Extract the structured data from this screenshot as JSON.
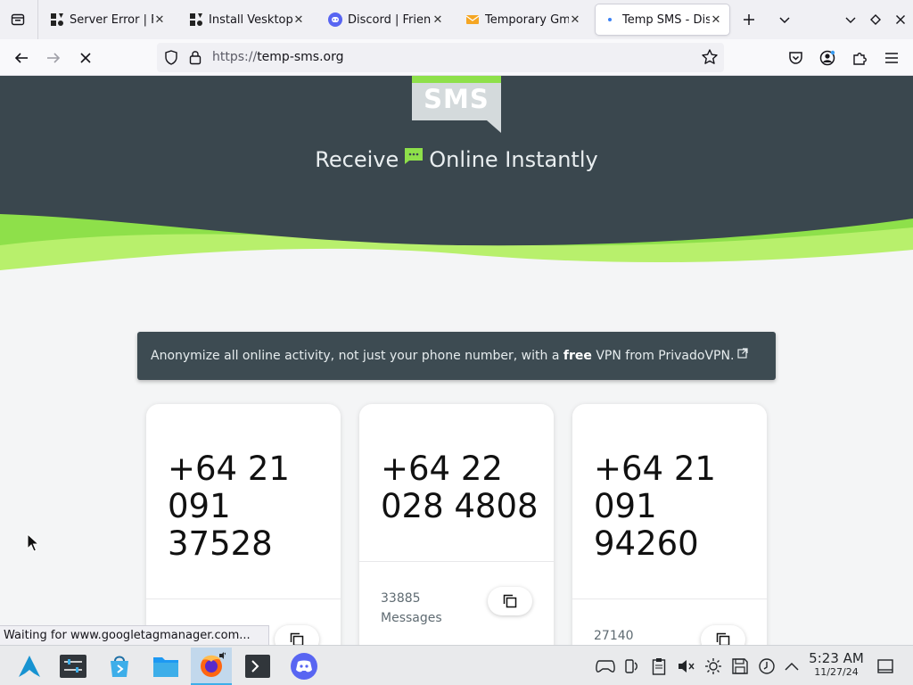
{
  "browser": {
    "tabs": [
      {
        "title": "Server Error | F",
        "icon": "bolt-app-icon"
      },
      {
        "title": "Install Vesktop",
        "icon": "bolt-app-icon"
      },
      {
        "title": "Discord | Frien",
        "icon": "discord-icon"
      },
      {
        "title": "Temporary Gm",
        "icon": "mail-icon"
      },
      {
        "title": "Temp SMS - Dis",
        "icon": "loading-dot-icon",
        "active": true
      }
    ],
    "close_glyph": "✕",
    "url_scheme": "https://",
    "url_host": "temp-sms.org"
  },
  "page": {
    "logo_text": "SMS",
    "tagline_before": "Receive",
    "tagline_after": "Online Instantly",
    "vpn_banner": {
      "text_before": "Anonymize all online activity, not just your phone number, with a ",
      "bold": "free",
      "text_after": " VPN from PrivadoVPN."
    },
    "numbers": [
      {
        "number": "+64 21 091 37528",
        "messages_count": "",
        "messages_label": ""
      },
      {
        "number": "+64 22 028 4808",
        "messages_count": "33885",
        "messages_label": "Messages"
      },
      {
        "number": "+64 21 091 94260",
        "messages_count": "27140",
        "messages_label": ""
      }
    ]
  },
  "status_tip": "Waiting for www.googletagmanager.com...",
  "taskbar": {
    "time": "5:23 AM",
    "date": "11/27/24",
    "apps": [
      "arch-launcher-icon",
      "mixer-settings-icon",
      "store-icon",
      "file-manager-icon",
      "firefox-icon",
      "terminal-icon",
      "discord-icon"
    ]
  },
  "colors": {
    "hero_dark": "#3a474e",
    "accent_green": "#8ee04a",
    "banner_bg": "#3d4b52",
    "active_task": "#c2d8ec"
  }
}
